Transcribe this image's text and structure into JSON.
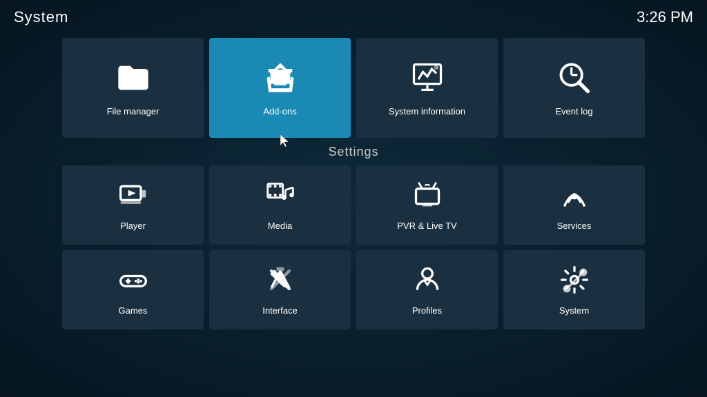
{
  "header": {
    "title": "System",
    "clock": "3:26 PM"
  },
  "top_tiles": [
    {
      "id": "file-manager",
      "label": "File manager",
      "icon": "folder"
    },
    {
      "id": "add-ons",
      "label": "Add-ons",
      "icon": "addons",
      "active": true
    },
    {
      "id": "system-information",
      "label": "System information",
      "icon": "sysinfo"
    },
    {
      "id": "event-log",
      "label": "Event log",
      "icon": "eventlog"
    }
  ],
  "settings_label": "Settings",
  "middle_tiles": [
    {
      "id": "player",
      "label": "Player",
      "icon": "player"
    },
    {
      "id": "media",
      "label": "Media",
      "icon": "media"
    },
    {
      "id": "pvr-live-tv",
      "label": "PVR & Live TV",
      "icon": "pvr"
    },
    {
      "id": "services",
      "label": "Services",
      "icon": "services"
    }
  ],
  "bottom_tiles": [
    {
      "id": "games",
      "label": "Games",
      "icon": "games"
    },
    {
      "id": "interface",
      "label": "Interface",
      "icon": "interface"
    },
    {
      "id": "profiles",
      "label": "Profiles",
      "icon": "profiles"
    },
    {
      "id": "system",
      "label": "System",
      "icon": "system"
    }
  ]
}
